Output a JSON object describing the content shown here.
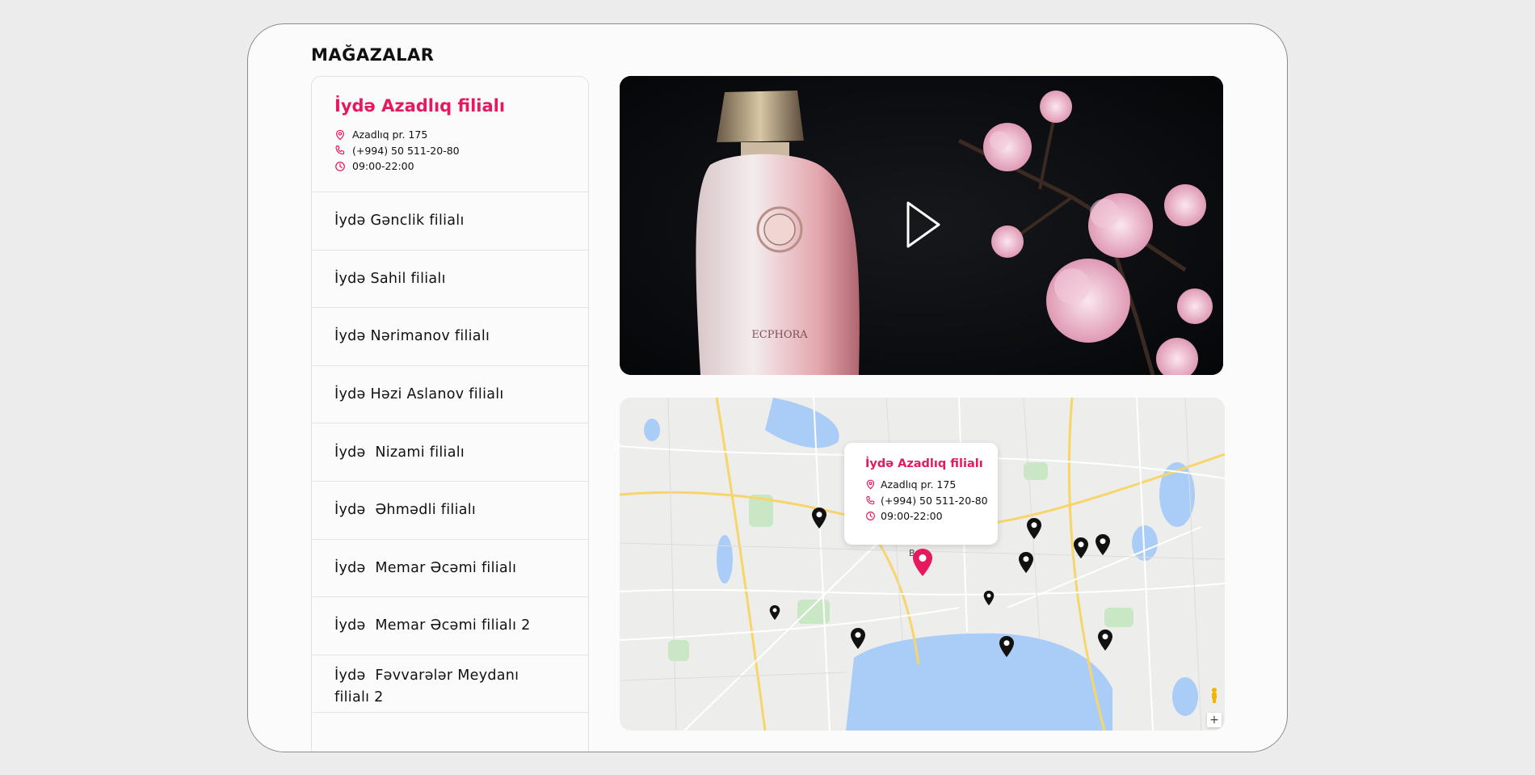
{
  "page": {
    "title": "MAĞAZALAR"
  },
  "active_store": {
    "name": "İydə Azadlıq filialı",
    "address": "Azadlıq pr. 175",
    "phone": "(+994) 50 511-20-80",
    "hours": "09:00-22:00"
  },
  "stores": [
    {
      "label": "İydə Gənclik filialı"
    },
    {
      "label": "İydə Sahil filialı"
    },
    {
      "label": "İydə Nərimanov filialı"
    },
    {
      "label": "İydə Həzi Aslanov filialı"
    },
    {
      "label": "İydə  Nizami filialı"
    },
    {
      "label": "İydə  Əhmədli filialı"
    },
    {
      "label": "İydə  Memar Əcəmi filialı"
    },
    {
      "label": "İydə  Memar Əcəmi filialı 2"
    },
    {
      "label": "İydə  Fəvvarələr Meydanı\nfilialı 2"
    }
  ],
  "video": {
    "play_icon": "play-icon",
    "bottle_label": "ECPHORA"
  },
  "map": {
    "popup": {
      "name": "İydə Azadlıq filialı",
      "address": "Azadlıq pr. 175",
      "phone": "(+994) 50 511-20-80",
      "hours": "09:00-22:00"
    },
    "zoom_in_label": "+",
    "labels": {
      "baku": "Bakı"
    }
  },
  "colors": {
    "accent": "#e6195e",
    "marker": "#111111",
    "water": "#aacdf7",
    "map_land": "#ededeb"
  }
}
